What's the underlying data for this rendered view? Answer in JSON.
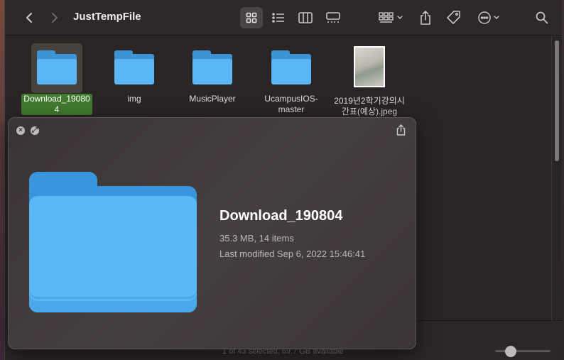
{
  "window": {
    "title": "JustTempFile"
  },
  "toolbar": {
    "back_icon": "chevron-left-icon",
    "forward_icon": "chevron-right-icon",
    "view_icons": [
      "grid-view-icon",
      "list-view-icon",
      "column-view-icon",
      "gallery-view-icon"
    ],
    "active_view": "grid-view-icon",
    "group_icon": "group-by-icon",
    "share_icon": "share-icon",
    "tag_icon": "tag-icon",
    "more_icon": "more-actions-icon",
    "search_icon": "search-icon"
  },
  "files": [
    {
      "name": "Download_19080",
      "name_line2": "4",
      "kind": "folder",
      "selected": true
    },
    {
      "name": "img",
      "name_line2": "",
      "kind": "folder",
      "selected": false
    },
    {
      "name": "MusicPlayer",
      "name_line2": "",
      "kind": "folder",
      "selected": false
    },
    {
      "name": "UcampusIOS-",
      "name_line2": "master",
      "kind": "folder",
      "selected": false
    },
    {
      "name": "2019년2학기강의시",
      "name_line2": "간표(예상).jpeg",
      "kind": "image",
      "selected": false
    }
  ],
  "status": {
    "text": "1 of 43 selected, 69.7 GB available"
  },
  "quicklook": {
    "close_icon": "close-icon",
    "fullscreen_icon": "fullscreen-icon",
    "share_icon": "share-icon",
    "name": "Download_190804",
    "size_items": "35.3 MB, 14 items",
    "modified": "Last modified Sep 6, 2022 15:46:41"
  },
  "colors": {
    "folder_front": "#5ab8f6",
    "folder_back": "#3a95de",
    "selection": "#3f7a2e"
  }
}
